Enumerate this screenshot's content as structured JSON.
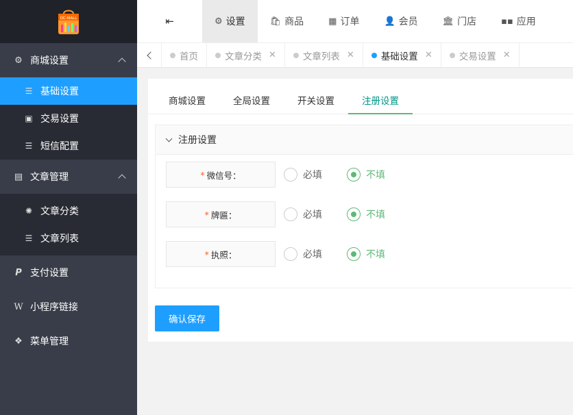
{
  "logo": {
    "text": "OC-MALL"
  },
  "sidebar": {
    "groups": [
      {
        "label": "商城设置",
        "icon": "gear-icon",
        "expanded": true,
        "items": [
          {
            "label": "基础设置",
            "icon": "list-icon",
            "active": true
          },
          {
            "label": "交易设置",
            "icon": "id-card-icon"
          },
          {
            "label": "短信配置",
            "icon": "list-icon"
          }
        ]
      },
      {
        "label": "文章管理",
        "icon": "newspaper-icon",
        "expanded": true,
        "items": [
          {
            "label": "文章分类",
            "icon": "cog-icon"
          },
          {
            "label": "文章列表",
            "icon": "list-icon"
          }
        ]
      },
      {
        "label": "支付设置",
        "icon": "paypal-icon"
      },
      {
        "label": "小程序链接",
        "icon": "w-icon"
      },
      {
        "label": "菜单管理",
        "icon": "cubes-icon"
      }
    ]
  },
  "topnav": {
    "items": [
      {
        "label": "设置",
        "icon": "gears-icon",
        "active": true
      },
      {
        "label": "商品",
        "icon": "bag-icon"
      },
      {
        "label": "订单",
        "icon": "table-icon"
      },
      {
        "label": "会员",
        "icon": "user-icon"
      },
      {
        "label": "门店",
        "icon": "bank-icon"
      },
      {
        "label": "应用",
        "icon": "grid-icon"
      }
    ]
  },
  "tabs": [
    {
      "label": "首页",
      "closable": false
    },
    {
      "label": "文章分类",
      "closable": true
    },
    {
      "label": "文章列表",
      "closable": true
    },
    {
      "label": "基础设置",
      "closable": true,
      "active": true
    },
    {
      "label": "交易设置",
      "closable": true
    }
  ],
  "subtabs": [
    {
      "label": "商城设置"
    },
    {
      "label": "全局设置"
    },
    {
      "label": "开关设置"
    },
    {
      "label": "注册设置",
      "active": true
    }
  ],
  "panel": {
    "title": "注册设置",
    "fields": [
      {
        "label": "微信号：",
        "required": true,
        "options": [
          "必填",
          "不填"
        ],
        "selected": "不填"
      },
      {
        "label": "牌匾：",
        "required": true,
        "options": [
          "必填",
          "不填"
        ],
        "selected": "不填"
      },
      {
        "label": "执照：",
        "required": true,
        "options": [
          "必填",
          "不填"
        ],
        "selected": "不填"
      }
    ]
  },
  "actions": {
    "save_label": "确认保存"
  },
  "colors": {
    "primary": "#1e9fff",
    "success": "#5fb878",
    "sidebar": "#393d49",
    "required": "#ff5722"
  }
}
